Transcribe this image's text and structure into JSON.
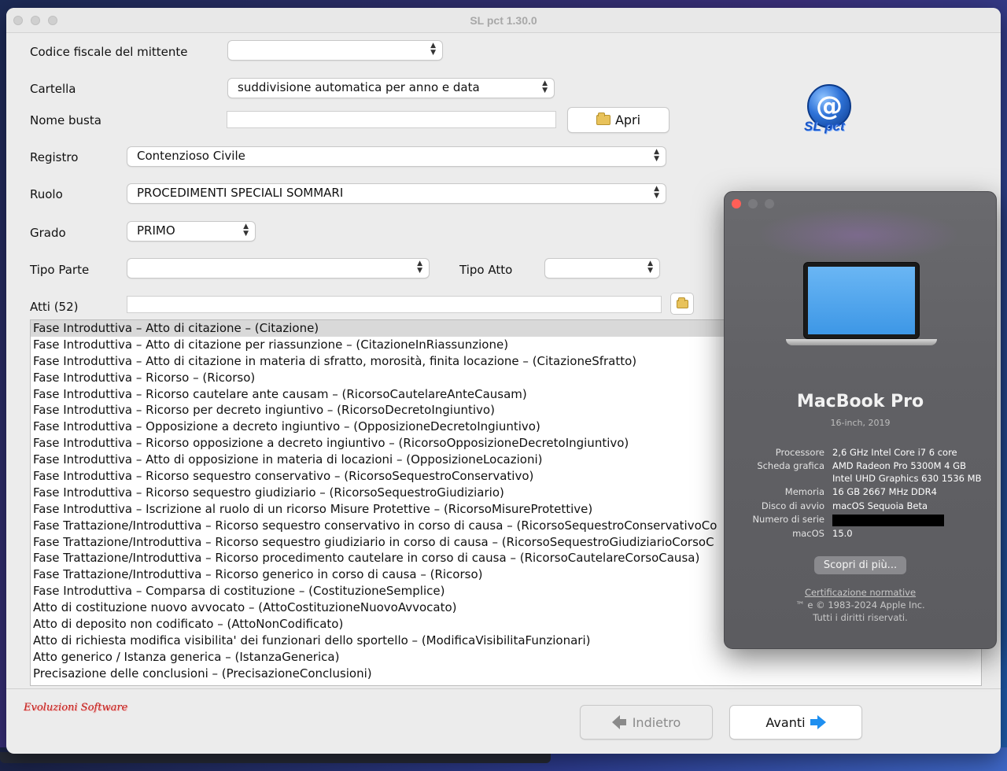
{
  "window": {
    "title": "SL pct 1.30.0"
  },
  "form": {
    "codice_fiscale_label": "Codice fiscale del mittente",
    "codice_fiscale_value": "",
    "cartella_label": "Cartella",
    "cartella_value": "suddivisione automatica per anno e data",
    "nome_busta_label": "Nome busta",
    "nome_busta_value": "",
    "apri_label": "Apri",
    "registro_label": "Registro",
    "registro_value": "Contenzioso Civile",
    "ruolo_label": "Ruolo",
    "ruolo_value": "PROCEDIMENTI SPECIALI SOMMARI",
    "grado_label": "Grado",
    "grado_value": "PRIMO",
    "tipo_parte_label": "Tipo Parte",
    "tipo_parte_value": "",
    "tipo_atto_label": "Tipo Atto",
    "tipo_atto_value": "",
    "atti_label": "Atti (52)",
    "atti_filter_value": ""
  },
  "logo": {
    "symbol": "@",
    "text": "SL pct"
  },
  "atti_list": [
    "Fase Introduttiva – Atto di citazione – (Citazione)",
    "Fase Introduttiva – Atto di citazione per riassunzione – (CitazioneInRiassunzione)",
    "Fase Introduttiva – Atto di citazione in materia di sfratto, morosità, finita locazione – (CitazioneSfratto)",
    "Fase Introduttiva – Ricorso – (Ricorso)",
    "Fase Introduttiva – Ricorso cautelare ante causam – (RicorsoCautelareAnteCausam)",
    "Fase Introduttiva – Ricorso per decreto ingiuntivo – (RicorsoDecretoIngiuntivo)",
    "Fase Introduttiva – Opposizione a decreto ingiuntivo – (OpposizioneDecretoIngiuntivo)",
    "Fase Introduttiva – Ricorso opposizione a decreto ingiuntivo – (RicorsoOpposizioneDecretoIngiuntivo)",
    "Fase Introduttiva – Atto di opposizione in materia di locazioni – (OpposizioneLocazioni)",
    "Fase Introduttiva – Ricorso sequestro conservativo – (RicorsoSequestroConservativo)",
    "Fase Introduttiva – Ricorso sequestro giudiziario – (RicorsoSequestroGiudiziario)",
    "Fase Introduttiva – Iscrizione al ruolo di un ricorso Misure Protettive – (RicorsoMisureProtettive)",
    "Fase Trattazione/Introduttiva – Ricorso sequestro conservativo in corso di causa – (RicorsoSequestroConservativoCo",
    "Fase Trattazione/Introduttiva – Ricorso sequestro giudiziario in corso di causa – (RicorsoSequestroGiudiziarioCorsoC",
    "Fase Trattazione/Introduttiva – Ricorso procedimento cautelare in corso di causa – (RicorsoCautelareCorsoCausa)",
    "Fase Trattazione/Introduttiva – Ricorso generico in corso di causa – (Ricorso)",
    "Fase Introduttiva – Comparsa di costituzione – (CostituzioneSemplice)",
    "Atto di costituzione nuovo avvocato – (AttoCostituzioneNuovoAvvocato)",
    "Atto di deposito non codificato – (AttoNonCodificato)",
    "Atto di richiesta modifica visibilita' dei funzionari dello sportello – (ModificaVisibilitaFunzionari)",
    "Atto generico / Istanza generica – (IstanzaGenerica)",
    "Precisazione delle conclusioni – (PrecisazioneConclusioni)"
  ],
  "footer": {
    "brand": "Evoluzioni Software",
    "back_label": "Indietro",
    "next_label": "Avanti"
  },
  "about_mac": {
    "model": "MacBook Pro",
    "subtitle": "16-inch, 2019",
    "specs": [
      {
        "key": "Processore",
        "value": "2,6 GHz Intel Core i7 6 core"
      },
      {
        "key": "Scheda grafica",
        "value": "AMD Radeon Pro 5300M 4 GB"
      },
      {
        "key": "",
        "value": "Intel UHD Graphics 630 1536 MB"
      },
      {
        "key": "Memoria",
        "value": "16 GB 2667 MHz DDR4"
      },
      {
        "key": "Disco di avvio",
        "value": "macOS Sequoia Beta"
      },
      {
        "key": "Numero di serie",
        "value": ""
      },
      {
        "key": "macOS",
        "value": "15.0"
      }
    ],
    "more_button": "Scopri di più...",
    "certification": "Certificazione normative",
    "copyright": "™ e © 1983-2024 Apple Inc.",
    "rights": "Tutti i diritti riservati."
  }
}
